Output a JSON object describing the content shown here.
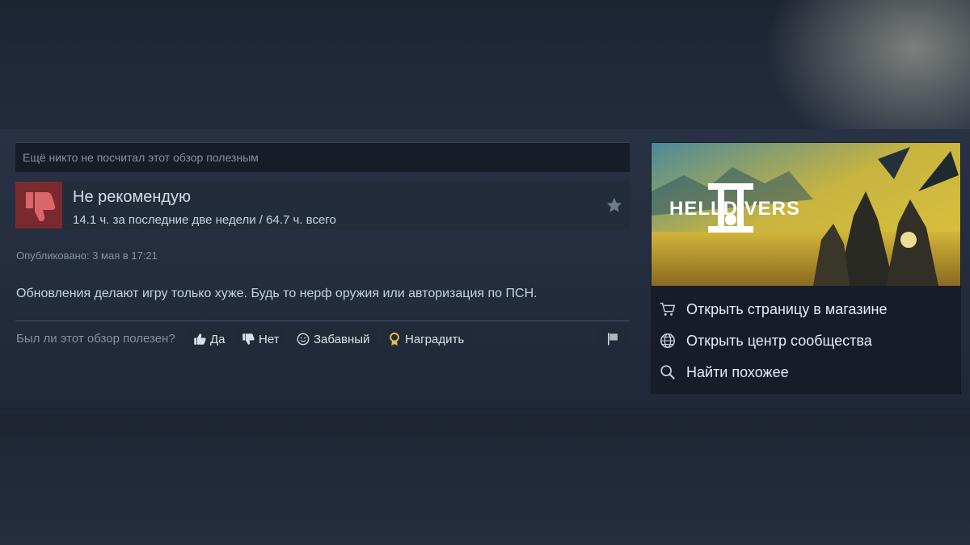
{
  "review": {
    "helpful_status": "Ещё никто не посчитал этот обзор полезным",
    "verdict": "Не рекомендую",
    "hours": "14.1 ч. за последние две недели / 64.7 ч. всего",
    "posted": "Опубликовано: 3 мая в 17:21",
    "text": "Обновления делают игру только хуже. Будь то нерф оружия или авторизация по ПСН."
  },
  "voting": {
    "question": "Был ли этот обзор полезен?",
    "yes_label": "Да",
    "no_label": "Нет",
    "funny_label": "Забавный",
    "award_label": "Наградить"
  },
  "game": {
    "logo_text": "HELLDIVERS",
    "links": {
      "store": "Открыть страницу в магазине",
      "community": "Открыть центр сообщества",
      "similar": "Найти похожее"
    }
  },
  "icons": {
    "thumb": "thumbs-down-icon",
    "star": "star-icon",
    "yes": "thumbs-up-icon",
    "no": "thumbs-down-small-icon",
    "funny": "smiley-icon",
    "award": "award-medal-icon",
    "flag": "flag-icon",
    "store": "cart-icon",
    "community": "globe-icon",
    "similar": "search-icon"
  },
  "colors": {
    "thumb_bg": "#7a2a2e",
    "award_gold": "#e7c04a"
  }
}
